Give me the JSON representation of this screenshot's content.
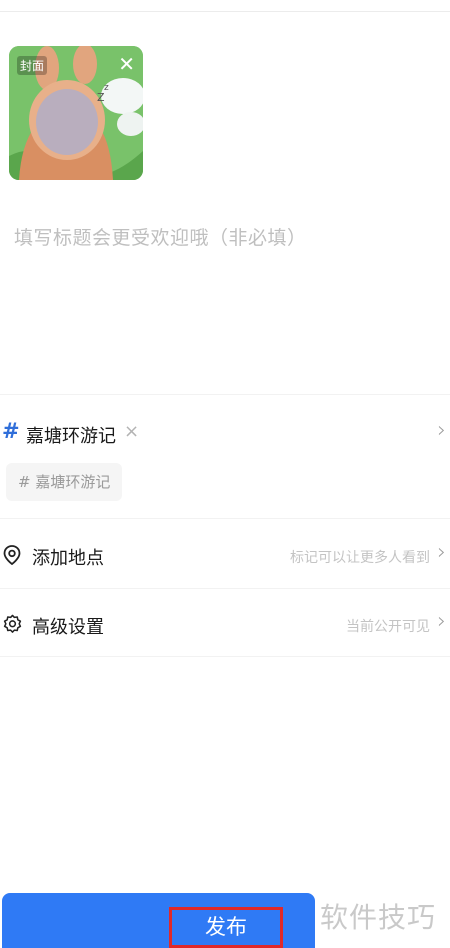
{
  "image": {
    "cover_tag": "封面",
    "close_glyph": "✕"
  },
  "title": {
    "placeholder": "填写标题会更受欢迎哦（非必填）",
    "value": ""
  },
  "topic": {
    "hash": "#",
    "label": "嘉塘环游记",
    "remove_glyph": "×",
    "chip": "# 嘉塘环游记",
    "chevron": "›"
  },
  "location": {
    "label": "添加地点",
    "hint": "标记可以让更多人看到",
    "chevron": "›",
    "icon": "location-pin-icon"
  },
  "advanced": {
    "label": "高级设置",
    "hint": "当前公开可见",
    "chevron": "›",
    "icon": "gear-icon"
  },
  "publish": {
    "label": "发布"
  },
  "watermark": {
    "text": "软件技巧"
  },
  "colors": {
    "accent": "#2f7af5",
    "highlight": "#e0292a",
    "hash": "#2f6ed9"
  }
}
